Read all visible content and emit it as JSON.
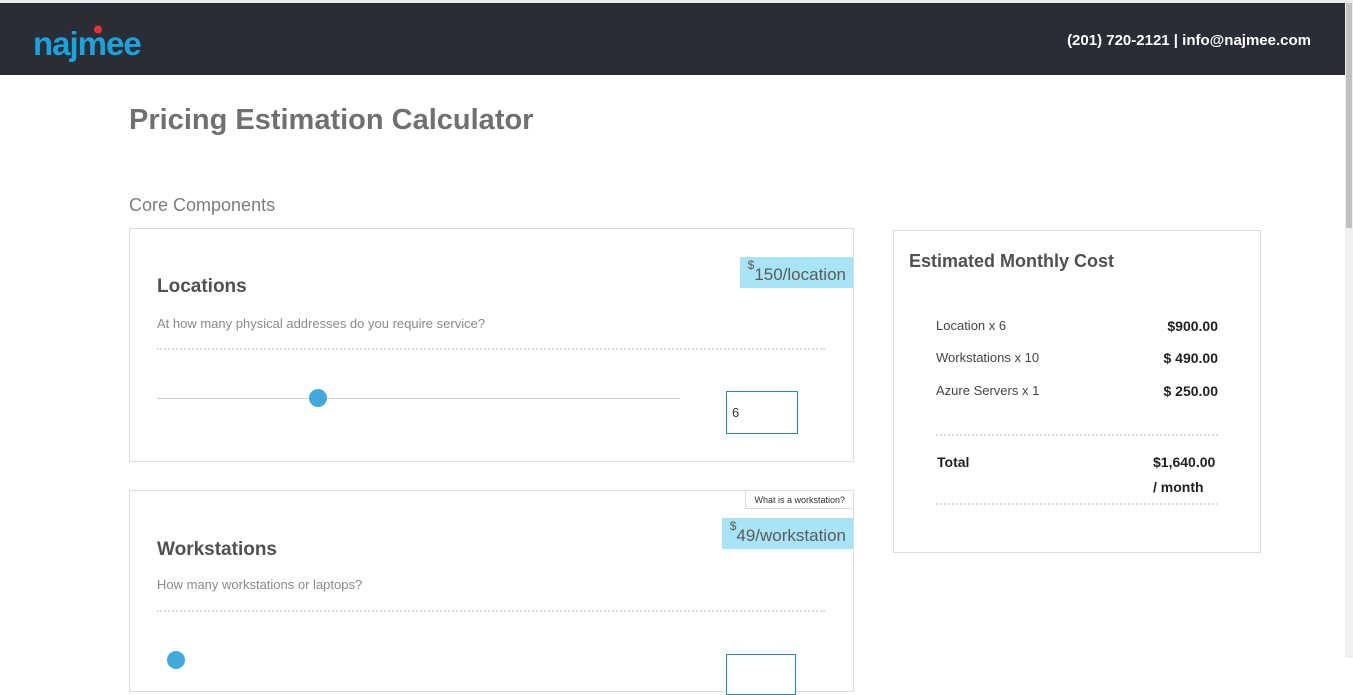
{
  "brand": {
    "logo_text": "najmee",
    "logo_color": "#1aa3dd",
    "dot_color": "#e0323a"
  },
  "header": {
    "contact": "(201) 720-2121 | info@najmee.com"
  },
  "page": {
    "title": "Pricing Estimation Calculator",
    "section": "Core Components"
  },
  "locations": {
    "title": "Locations",
    "question": "At how many physical addresses do you require service?",
    "price_symbol": "$",
    "price": "150/location",
    "value": "6",
    "slider_fraction": 0.3
  },
  "workstations": {
    "title": "Workstations",
    "question": "How many workstations or laptops?",
    "tooltip": "What is a workstation?",
    "price_symbol": "$",
    "price": "49/workstation"
  },
  "summary": {
    "title": "Estimated Monthly Cost",
    "rows": [
      {
        "label": "Location x 6",
        "value": "$900.00"
      },
      {
        "label": "Workstations x 10",
        "value": "$ 490.00"
      },
      {
        "label": "Azure Servers x 1",
        "value": "$ 250.00"
      }
    ],
    "total_label": "Total",
    "total_value": "$1,640.00",
    "period": "/ month"
  }
}
